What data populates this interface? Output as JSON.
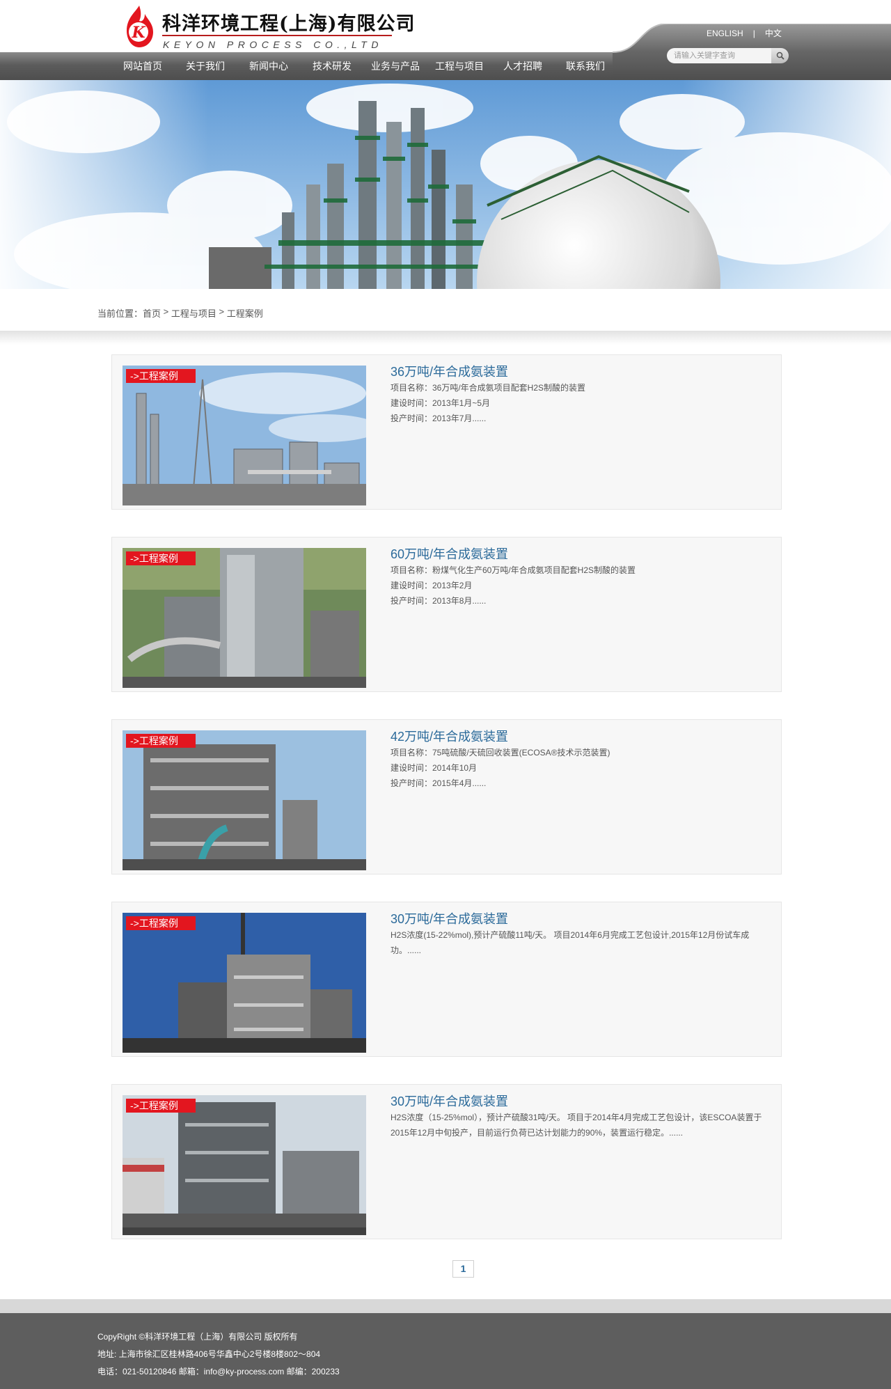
{
  "brand": {
    "name_cn": "科洋环境工程(上海)有限公司",
    "name_en": "KEYON PROCESS CO.,LTD",
    "logo_letter": "K"
  },
  "nav": {
    "items": [
      {
        "label": "网站首页"
      },
      {
        "label": "关于我们"
      },
      {
        "label": "新闻中心"
      },
      {
        "label": "技术研发"
      },
      {
        "label": "业务与产品"
      },
      {
        "label": "工程与项目"
      },
      {
        "label": "人才招聘"
      },
      {
        "label": "联系我们"
      }
    ]
  },
  "lang": {
    "english": "ENGLISH",
    "separator": "|",
    "chinese": "中文"
  },
  "search": {
    "placeholder": "请输入关键字查询",
    "icon": "search-icon"
  },
  "breadcrumb": {
    "prefix": "当前位置：",
    "home": "首页",
    "sep": " > ",
    "section": "工程与项目",
    "current": "工程案例"
  },
  "cases": [
    {
      "tag": "->工程案例",
      "title": "36万吨/年合成氨装置",
      "lines": [
        "项目名称：36万吨/年合成氨项目配套H2S制酸的装置",
        "建设时间：2013年1月~5月",
        "投产时间：2013年7月......"
      ]
    },
    {
      "tag": "->工程案例",
      "title": "60万吨/年合成氨装置",
      "lines": [
        "项目名称：粉煤气化生产60万吨/年合成氨项目配套H2S制酸的装置",
        "建设时间：2013年2月",
        "投产时间：2013年8月......"
      ]
    },
    {
      "tag": "->工程案例",
      "title": "42万吨/年合成氨装置",
      "lines": [
        "项目名称：75吨硫酸/天硫回收装置(ECOSA®技术示范装置)",
        "建设时间：2014年10月",
        "投产时间：2015年4月......"
      ]
    },
    {
      "tag": "->工程案例",
      "title": "30万吨/年合成氨装置",
      "lines": [
        "H2S浓度(15-22%mol),预计产硫酸11吨/天。 项目2014年6月完成工艺包设计,2015年12月份试车成功。......"
      ]
    },
    {
      "tag": "->工程案例",
      "title": "30万吨/年合成氨装置",
      "lines": [
        "H2S浓度（15-25%mol），预计产硫酸31吨/天。 项目于2014年4月完成工艺包设计，该ESCOA装置于2015年12月中旬投产，目前运行负荷已达计划能力的90%，装置运行稳定。......"
      ]
    }
  ],
  "pager": {
    "current": "1"
  },
  "footer": {
    "copyright": "CopyRight ©科洋环境工程（上海）有限公司 版权所有",
    "address": "地址: 上海市徐汇区桂林路406号华鑫中心2号楼8楼802～804",
    "contact": "电话：021-50120846 邮箱：info@ky-process.com 邮编：200233"
  },
  "colors": {
    "accent_red": "#e3161f",
    "title_blue": "#2b6a9a",
    "nav_gray": "#5c5c5c",
    "footer_gray": "#5e5e5e"
  }
}
